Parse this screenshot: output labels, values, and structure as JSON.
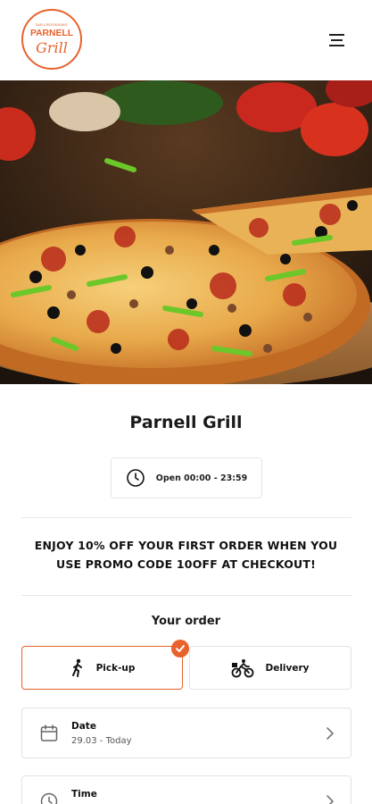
{
  "header": {
    "logo_text": "PARNELL",
    "logo_script": "Grill",
    "logo_subtext": "BAR & RESTAURANT",
    "menu_icon": "hamburger-menu-icon"
  },
  "hero": {
    "image": "pizza-photo"
  },
  "restaurant": {
    "name": "Parnell Grill",
    "hours": "Open 00:00 - 23:59",
    "hours_icon": "clock-icon"
  },
  "promo": {
    "line1": "ENJOY 10% OFF YOUR FIRST ORDER WHEN YOU",
    "line2": "USE PROMO CODE 10OFF AT CHECKOUT!"
  },
  "order": {
    "heading": "Your order",
    "options": [
      {
        "label": "Pick-up",
        "icon": "walking-person-icon",
        "selected": true
      },
      {
        "label": "Delivery",
        "icon": "cyclist-icon",
        "selected": false
      }
    ],
    "fields": [
      {
        "label": "Date",
        "value": "29.03 - Today",
        "icon": "calendar-icon"
      },
      {
        "label": "Time",
        "value": "",
        "icon": "clock-icon"
      }
    ]
  },
  "colors": {
    "accent": "#e8622c",
    "text": "#111111",
    "border": "#e3e3e3"
  }
}
